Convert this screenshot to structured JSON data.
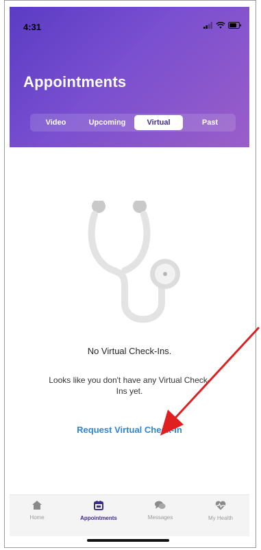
{
  "status_bar": {
    "time": "4:31"
  },
  "header": {
    "title": "Appointments",
    "tabs": [
      {
        "label": "Video",
        "active": false
      },
      {
        "label": "Upcoming",
        "active": false
      },
      {
        "label": "Virtual",
        "active": true
      },
      {
        "label": "Past",
        "active": false
      }
    ]
  },
  "empty_state": {
    "icon": "stethoscope-icon",
    "title": "No Virtual Check-Ins.",
    "message": "Looks like you don't have any Virtual Check-Ins yet.",
    "action_label": "Request Virtual Check-In"
  },
  "bottom_nav": {
    "items": [
      {
        "label": "Home",
        "icon": "home-icon",
        "active": false
      },
      {
        "label": "Appointments",
        "icon": "calendar-icon",
        "active": true
      },
      {
        "label": "Messages",
        "icon": "messages-icon",
        "active": false
      },
      {
        "label": "My Health",
        "icon": "heart-icon",
        "active": false
      }
    ]
  },
  "colors": {
    "header_gradient_start": "#5a3cc4",
    "header_gradient_end": "#9a5ec8",
    "link": "#2e86d8",
    "active_nav": "#3e2a8a",
    "annotation_arrow": "#e02020"
  }
}
